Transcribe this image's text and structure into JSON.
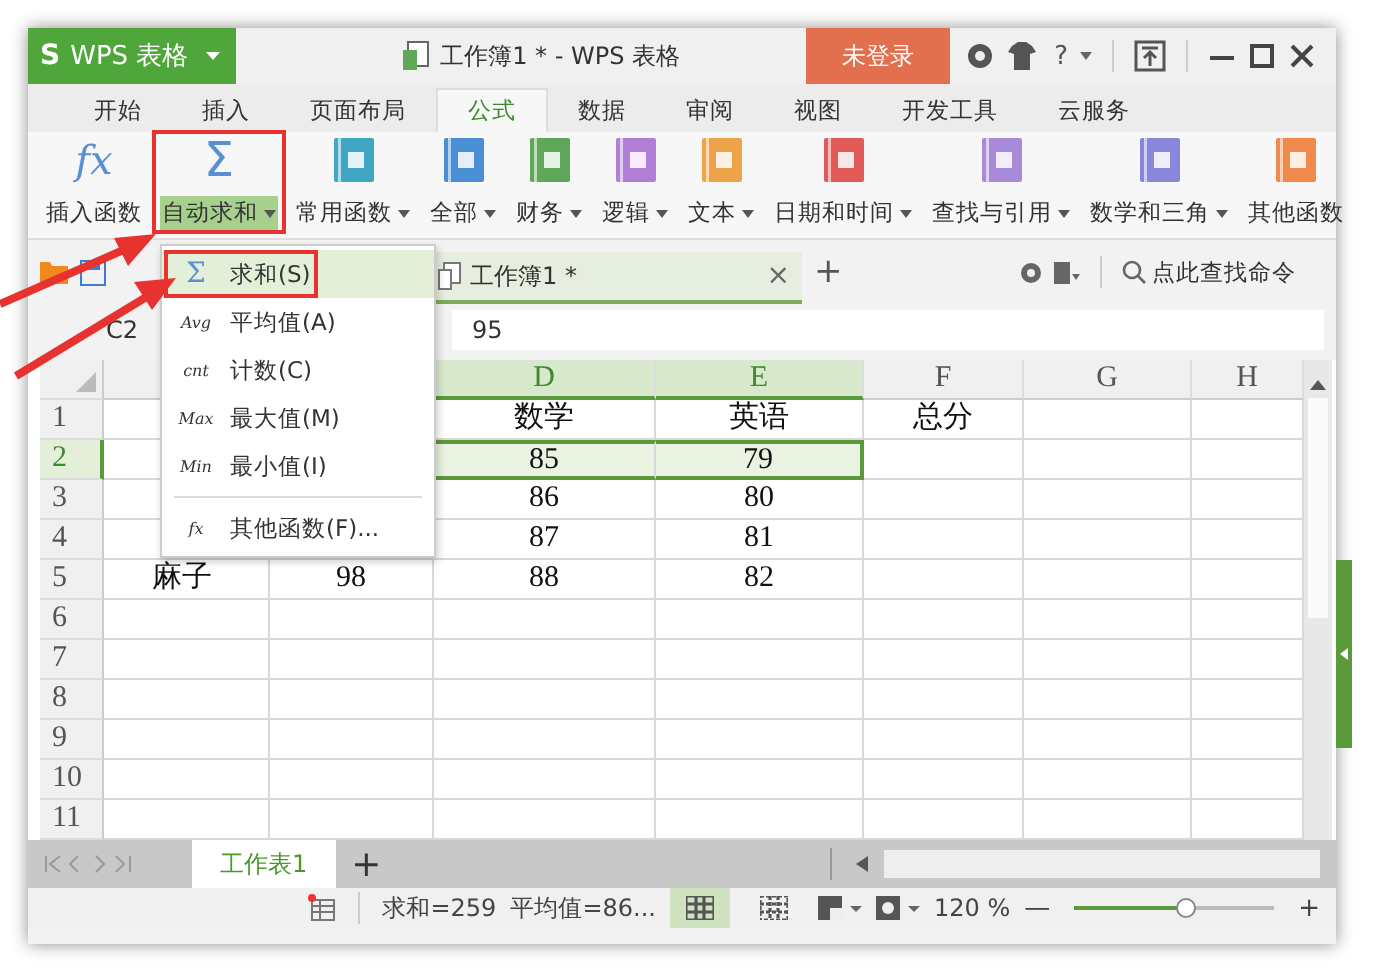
{
  "app": {
    "logo": "S",
    "name": "WPS 表格"
  },
  "window": {
    "title": "工作簿1 * - WPS 表格",
    "login": "未登录",
    "help": "?"
  },
  "tabs": [
    {
      "label": "开始",
      "selected": false
    },
    {
      "label": "插入",
      "selected": false
    },
    {
      "label": "页面布局",
      "selected": false
    },
    {
      "label": "公式",
      "selected": true
    },
    {
      "label": "数据",
      "selected": false
    },
    {
      "label": "审阅",
      "selected": false
    },
    {
      "label": "视图",
      "selected": false
    },
    {
      "label": "开发工具",
      "selected": false
    },
    {
      "label": "云服务",
      "selected": false
    }
  ],
  "ribbon": [
    {
      "label": "插入函数",
      "glyph": "fx",
      "dropdown": false,
      "highlighted": false
    },
    {
      "label": "自动求和",
      "glyph": "Σ",
      "dropdown": true,
      "highlighted": true
    },
    {
      "label": "常用函数",
      "dropdown": true,
      "highlighted": false
    },
    {
      "label": "全部",
      "dropdown": true,
      "highlighted": false
    },
    {
      "label": "财务",
      "dropdown": true,
      "highlighted": false
    },
    {
      "label": "逻辑",
      "dropdown": true,
      "highlighted": false
    },
    {
      "label": "文本",
      "dropdown": true,
      "highlighted": false
    },
    {
      "label": "日期和时间",
      "dropdown": true,
      "highlighted": false
    },
    {
      "label": "查找与引用",
      "dropdown": true,
      "highlighted": false
    },
    {
      "label": "数学和三角",
      "dropdown": true,
      "highlighted": false
    },
    {
      "label": "其他函数",
      "dropdown": false,
      "highlighted": false
    }
  ],
  "document_tab": {
    "label": "工作簿1 *",
    "close": "×",
    "add": "+"
  },
  "command_search": {
    "placeholder": "点此查找命令"
  },
  "formula_bar": {
    "cell": "C2",
    "value": "95"
  },
  "columns": [
    {
      "header": "D",
      "selected": true
    },
    {
      "header": "E",
      "selected": true
    },
    {
      "header": "F",
      "selected": false
    },
    {
      "header": "G",
      "selected": false
    },
    {
      "header": "H",
      "selected": false
    }
  ],
  "rows": [
    {
      "number": "1",
      "selected": false,
      "cells": [
        null,
        null,
        "数学",
        "英语",
        "总分"
      ]
    },
    {
      "number": "2",
      "selected": true,
      "cells": [
        null,
        null,
        "85",
        "79"
      ]
    },
    {
      "number": "3",
      "selected": false,
      "cells": [
        null,
        null,
        "86",
        "80"
      ]
    },
    {
      "number": "4",
      "selected": false,
      "cells": [
        null,
        null,
        "87",
        "81"
      ]
    },
    {
      "number": "5",
      "selected": false,
      "cells": [
        "麻子",
        "98",
        "88",
        "82"
      ]
    },
    {
      "number": "6",
      "selected": false
    },
    {
      "number": "7",
      "selected": false
    },
    {
      "number": "8",
      "selected": false
    },
    {
      "number": "9",
      "selected": false
    },
    {
      "number": "10",
      "selected": false
    },
    {
      "number": "11",
      "selected": false
    }
  ],
  "autosum_menu": [
    {
      "glyph": "Σ",
      "label": "求和(S)",
      "selected": true,
      "highlighted": true
    },
    {
      "glyph": "Avg",
      "label": "平均值(A)",
      "selected": false
    },
    {
      "glyph": "cnt",
      "label": "计数(C)",
      "selected": false
    },
    {
      "glyph": "Max",
      "label": "最大值(M)",
      "selected": false
    },
    {
      "glyph": "Min",
      "label": "最小值(I)",
      "selected": false
    },
    {
      "glyph": "fx",
      "label": "其他函数(F)...",
      "selected": false,
      "separated": true
    }
  ],
  "sheet_tabs": [
    {
      "label": "工作表1",
      "selected": true
    }
  ],
  "add_sheet": "+",
  "status_bar": {
    "sum": "求和=259",
    "average": "平均值=86...",
    "zoom": "120 %",
    "zoom_out": "—",
    "zoom_in": "+",
    "level": 0.55
  }
}
